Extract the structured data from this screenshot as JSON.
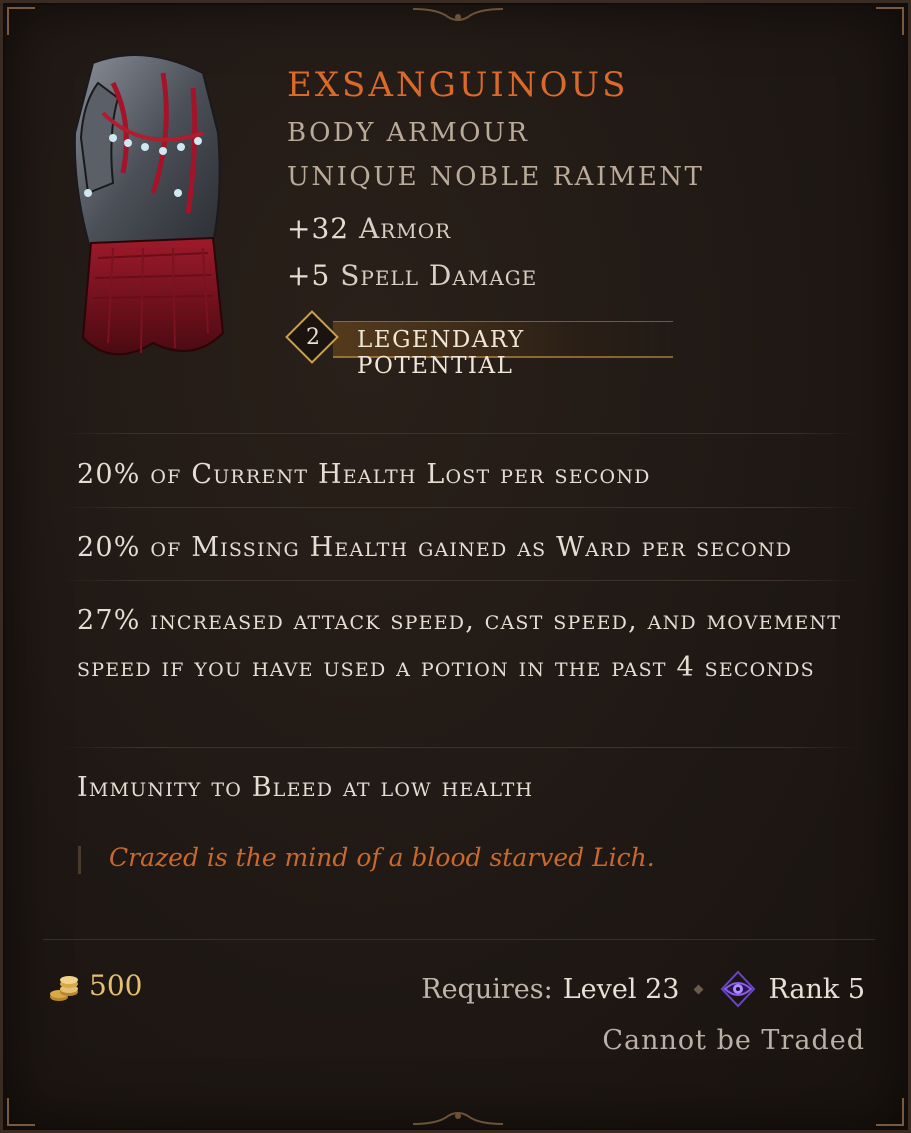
{
  "item": {
    "name": "EXSANGUINOUS",
    "type": "BODY ARMOUR",
    "base": "UNIQUE NOBLE RAIMENT",
    "implicits": [
      {
        "value": "+32",
        "stat": "Armor"
      },
      {
        "value": "+5",
        "stat": "Spell Damage"
      }
    ],
    "legendary_potential": {
      "value": "2",
      "label": "LEGENDARY POTENTIAL"
    },
    "affixes": [
      "20% of Current Health Lost per second",
      "20% of Missing Health gained as Ward per second",
      "27% increased attack speed, cast speed, and movement speed if you have used a potion in the past 4 seconds",
      "Immunity to Bleed at low health"
    ],
    "lore": "Crazed is the mind of a blood starved Lich."
  },
  "footer": {
    "gold": "500",
    "requires_label": "Requires:",
    "level": "Level 23",
    "rank": "Rank 5",
    "trade_status": "Cannot be Traded"
  },
  "colors": {
    "title": "#d96a2a",
    "lore": "#c9692c",
    "gold": "#e4c070",
    "rank_icon": "#8a5cf0"
  },
  "icons": {
    "item": "body-armour-image",
    "gold": "gold-coins-icon",
    "rank": "eye-rank-icon"
  }
}
